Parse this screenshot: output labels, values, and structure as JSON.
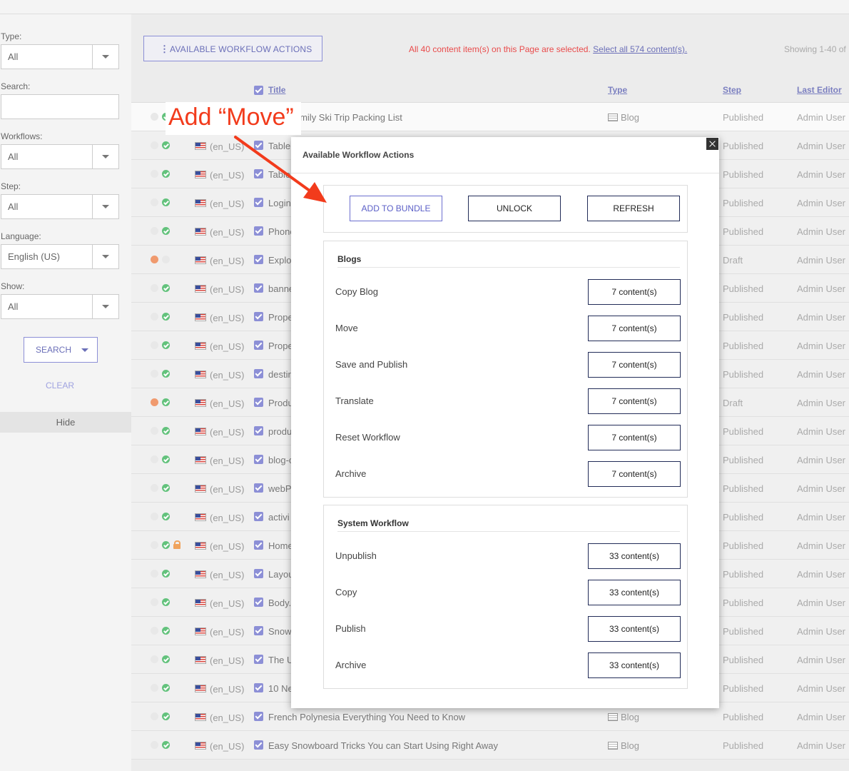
{
  "sidebar": {
    "type_label": "Type:",
    "type_value": "All",
    "search_label": "Search:",
    "workflows_label": "Workflows:",
    "workflows_value": "All",
    "step_label": "Step:",
    "step_value": "All",
    "language_label": "Language:",
    "language_value": "English (US)",
    "show_label": "Show:",
    "show_value": "All",
    "search_button": "SEARCH",
    "clear_link": "CLEAR",
    "hide_label": "Hide"
  },
  "toolbar": {
    "workflow_button": "AVAILABLE WORKFLOW ACTIONS",
    "selection_message": "All 40 content item(s) on this Page are selected.",
    "select_all_link": "Select all 574 content(s).",
    "showing": "Showing 1-40 of"
  },
  "table": {
    "headers": {
      "title": "Title",
      "type": "Type",
      "step": "Step",
      "last_editor": "Last Editor"
    },
    "rows": [
      {
        "locale": "",
        "title": "nate Family Ski Trip Packing List",
        "type": "Blog",
        "step": "Published",
        "editor": "Admin User",
        "dot1": "grey",
        "dot2": "green",
        "lock": false
      },
      {
        "locale": "(en_US)",
        "title": "Table",
        "type": "",
        "step": "Published",
        "editor": "Admin User",
        "dot1": "grey",
        "dot2": "green",
        "lock": false
      },
      {
        "locale": "(en_US)",
        "title": "Table",
        "type": "",
        "step": "Published",
        "editor": "Admin User",
        "dot1": "grey",
        "dot2": "green",
        "lock": false
      },
      {
        "locale": "(en_US)",
        "title": "Login",
        "type": "",
        "step": "Published",
        "editor": "Admin User",
        "dot1": "grey",
        "dot2": "green",
        "lock": false
      },
      {
        "locale": "(en_US)",
        "title": "Phone",
        "type": "",
        "step": "Published",
        "editor": "Admin User",
        "dot1": "grey",
        "dot2": "green",
        "lock": false
      },
      {
        "locale": "(en_US)",
        "title": "Explo",
        "type": "",
        "step": "Draft",
        "editor": "Admin User",
        "dot1": "orange",
        "dot2": "grey",
        "lock": false
      },
      {
        "locale": "(en_US)",
        "title": "banne",
        "type": "",
        "step": "Published",
        "editor": "Admin User",
        "dot1": "grey",
        "dot2": "green",
        "lock": false
      },
      {
        "locale": "(en_US)",
        "title": "Prope",
        "type": "",
        "step": "Published",
        "editor": "Admin User",
        "dot1": "grey",
        "dot2": "green",
        "lock": false
      },
      {
        "locale": "(en_US)",
        "title": "Prope",
        "type": "",
        "step": "Published",
        "editor": "Admin User",
        "dot1": "grey",
        "dot2": "green",
        "lock": false
      },
      {
        "locale": "(en_US)",
        "title": "destir",
        "type": "",
        "step": "Published",
        "editor": "Admin User",
        "dot1": "grey",
        "dot2": "green",
        "lock": false
      },
      {
        "locale": "(en_US)",
        "title": "Produ",
        "type": "",
        "step": "Draft",
        "editor": "Admin User",
        "dot1": "orange",
        "dot2": "green",
        "lock": false
      },
      {
        "locale": "(en_US)",
        "title": "produ",
        "type": "",
        "step": "Published",
        "editor": "Admin User",
        "dot1": "grey",
        "dot2": "green",
        "lock": false
      },
      {
        "locale": "(en_US)",
        "title": "blog-c",
        "type": "",
        "step": "Published",
        "editor": "Admin User",
        "dot1": "grey",
        "dot2": "green",
        "lock": false
      },
      {
        "locale": "(en_US)",
        "title": "webP",
        "type": "",
        "step": "Published",
        "editor": "Admin User",
        "dot1": "grey",
        "dot2": "green",
        "lock": false
      },
      {
        "locale": "(en_US)",
        "title": "activi",
        "type": "",
        "step": "Published",
        "editor": "Admin User",
        "dot1": "grey",
        "dot2": "green",
        "lock": false
      },
      {
        "locale": "(en_US)",
        "title": "Home",
        "type": "",
        "step": "Published",
        "editor": "Admin User",
        "dot1": "grey",
        "dot2": "green",
        "lock": true
      },
      {
        "locale": "(en_US)",
        "title": "Layou",
        "type": "",
        "step": "Published",
        "editor": "Admin User",
        "dot1": "grey",
        "dot2": "green",
        "lock": false
      },
      {
        "locale": "(en_US)",
        "title": "Body.",
        "type": "",
        "step": "Published",
        "editor": "Admin User",
        "dot1": "grey",
        "dot2": "green",
        "lock": false
      },
      {
        "locale": "(en_US)",
        "title": "Snow",
        "type": "",
        "step": "Published",
        "editor": "Admin User",
        "dot1": "grey",
        "dot2": "green",
        "lock": false
      },
      {
        "locale": "(en_US)",
        "title": "The U",
        "type": "",
        "step": "Published",
        "editor": "Admin User",
        "dot1": "grey",
        "dot2": "green",
        "lock": false
      },
      {
        "locale": "(en_US)",
        "title": "10 Ne",
        "type": "",
        "step": "Published",
        "editor": "Admin User",
        "dot1": "grey",
        "dot2": "green",
        "lock": false
      },
      {
        "locale": "(en_US)",
        "title": "French Polynesia Everything You Need to Know",
        "type": "Blog",
        "step": "Published",
        "editor": "Admin User",
        "dot1": "grey",
        "dot2": "green",
        "lock": false
      },
      {
        "locale": "(en_US)",
        "title": "Easy Snowboard Tricks You can Start Using Right Away",
        "type": "Blog",
        "step": "Published",
        "editor": "Admin User",
        "dot1": "grey",
        "dot2": "green",
        "lock": false
      }
    ]
  },
  "modal": {
    "title": "Available Workflow Actions",
    "top_actions": [
      "ADD TO BUNDLE",
      "UNLOCK",
      "REFRESH"
    ],
    "groups": [
      {
        "name": "Blogs",
        "actions": [
          {
            "label": "Copy Blog",
            "count": "7 content(s)"
          },
          {
            "label": "Move",
            "count": "7 content(s)"
          },
          {
            "label": "Save and Publish",
            "count": "7 content(s)"
          },
          {
            "label": "Translate",
            "count": "7 content(s)"
          },
          {
            "label": "Reset Workflow",
            "count": "7 content(s)"
          },
          {
            "label": "Archive",
            "count": "7 content(s)"
          }
        ]
      },
      {
        "name": "System Workflow",
        "actions": [
          {
            "label": "Unpublish",
            "count": "33 content(s)"
          },
          {
            "label": "Copy",
            "count": "33 content(s)"
          },
          {
            "label": "Publish",
            "count": "33 content(s)"
          },
          {
            "label": "Archive",
            "count": "33 content(s)"
          }
        ]
      }
    ]
  },
  "annotation": {
    "text": "Add “Move”",
    "color": "#f23b1c"
  }
}
